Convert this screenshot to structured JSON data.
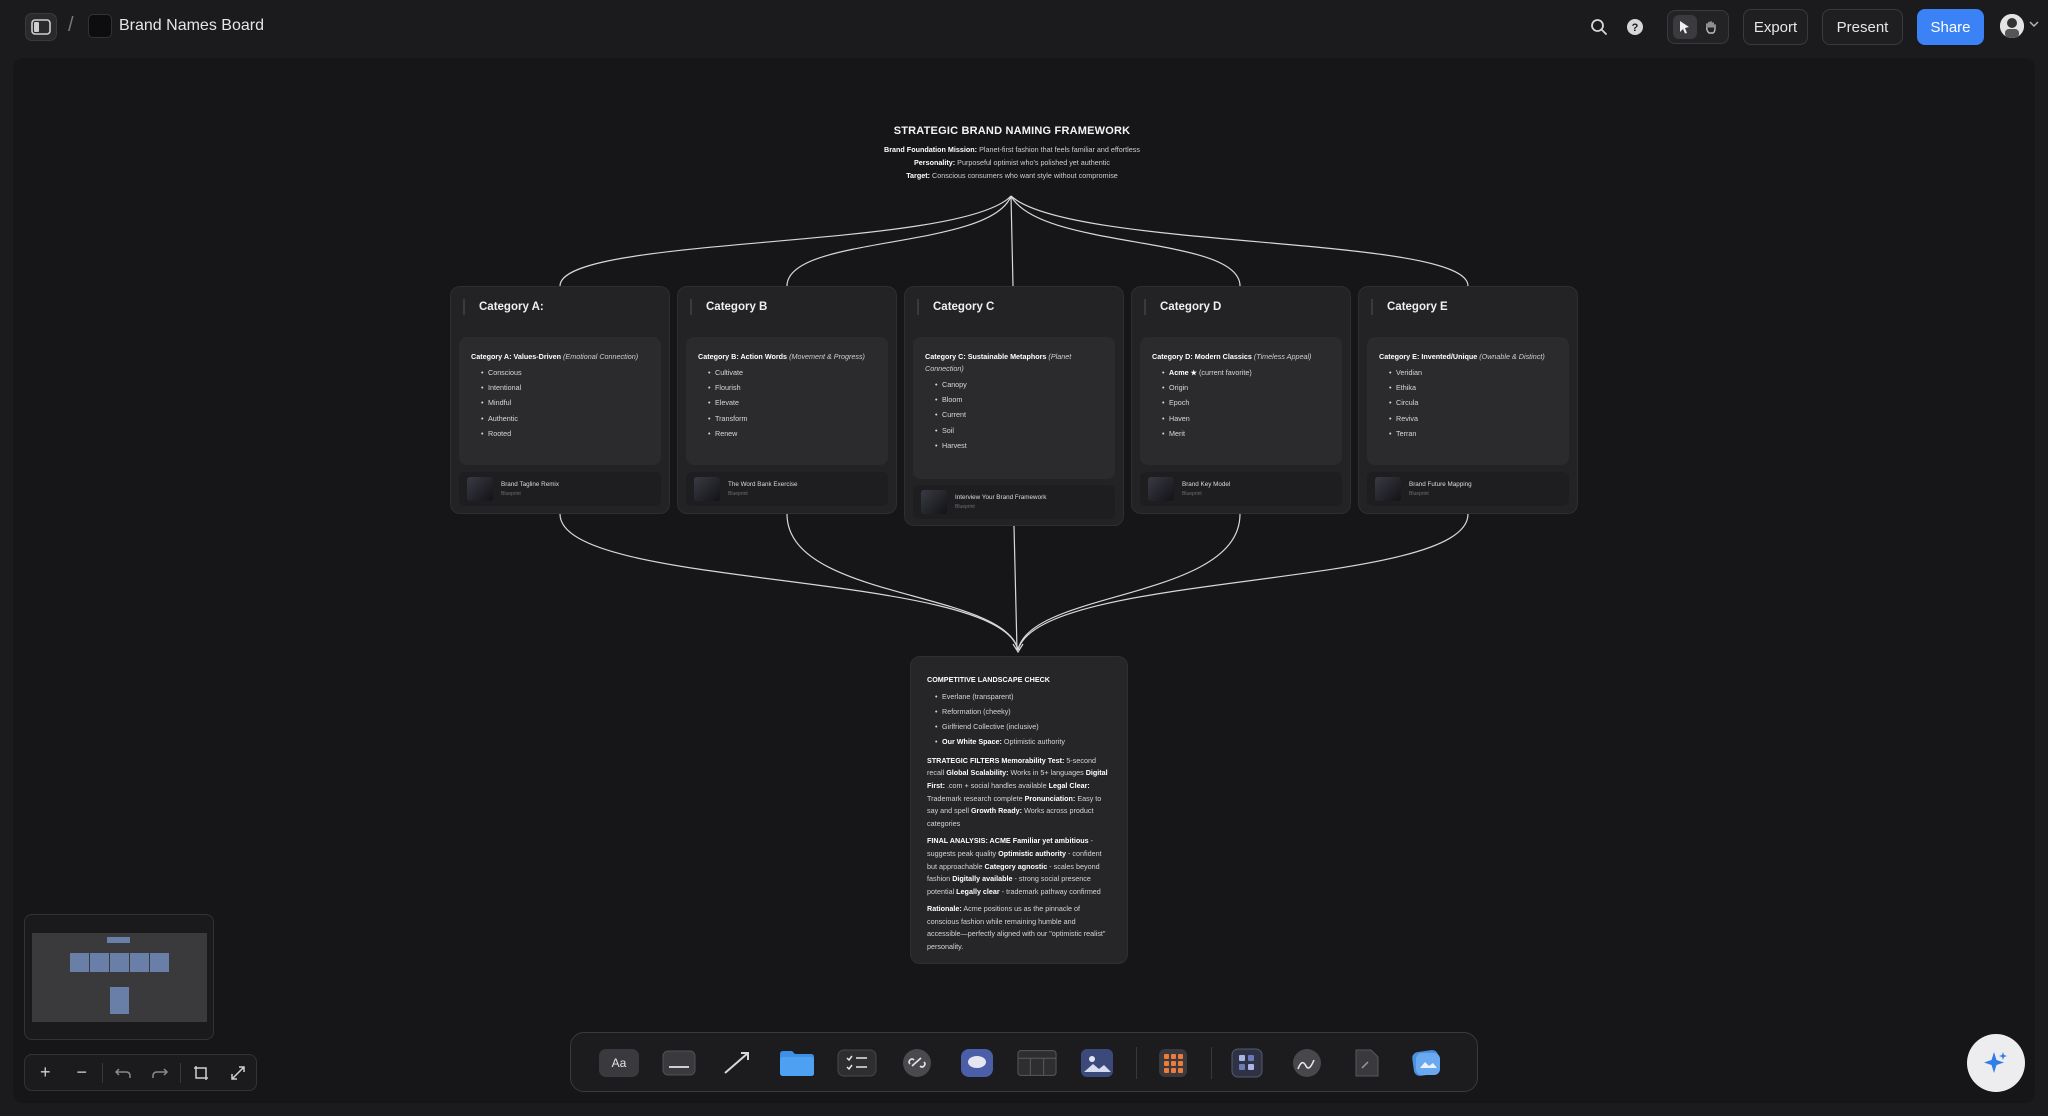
{
  "topbar": {
    "board_title": "Brand Names Board",
    "export_label": "Export",
    "present_label": "Present",
    "share_label": "Share"
  },
  "colors": {
    "accent": "#3b82f6",
    "canvas": "#161618",
    "card": "#232326"
  },
  "framework": {
    "title": "STRATEGIC BRAND NAMING FRAMEWORK",
    "foundation_label": "Brand Foundation Mission:",
    "mission_text": "Planet-first fashion that feels familiar and effortless",
    "personality_label": "Personality:",
    "personality_text": "Purposeful optimist who's polished yet authentic",
    "target_label": "Target:",
    "target_text": "Conscious consumers who want style without compromise"
  },
  "categories": [
    {
      "header": "Category A:",
      "title": "Category A: Values-Driven",
      "subtitle": "(Emotional Connection)",
      "items": [
        "Conscious",
        "Intentional",
        "Mindful",
        "Authentic",
        "Rooted"
      ],
      "doc_title": "Brand Tagline Remix",
      "doc_sub": "Blueprint"
    },
    {
      "header": "Category B",
      "title": "Category B: Action Words",
      "subtitle": "(Movement & Progress)",
      "items": [
        "Cultivate",
        "Flourish",
        "Elevate",
        "Transform",
        "Renew"
      ],
      "doc_title": "The Word Bank Exercise",
      "doc_sub": "Blueprint"
    },
    {
      "header": "Category C",
      "title": "Category C: Sustainable Metaphors",
      "subtitle": "(Planet Connection)",
      "items": [
        "Canopy",
        "Bloom",
        "Current",
        "Soil",
        "Harvest"
      ],
      "doc_title": "Interview Your Brand Framework",
      "doc_sub": "Blueprint"
    },
    {
      "header": "Category D",
      "title": "Category D: Modern Classics",
      "subtitle": "(Timeless Appeal)",
      "first_bold": "Acme ★",
      "first_rest": " (current favorite)",
      "items": [
        "Origin",
        "Epoch",
        "Haven",
        "Merit"
      ],
      "doc_title": "Brand Key Model",
      "doc_sub": "Blueprint"
    },
    {
      "header": "Category E",
      "title": "Category E: Invented/Unique",
      "subtitle": "(Ownable & Distinct)",
      "items": [
        "Veridian",
        "Ethika",
        "Circula",
        "Reviva",
        "Terran"
      ],
      "doc_title": "Brand Future Mapping",
      "doc_sub": "Blueprint"
    }
  ],
  "competitive": {
    "title": "COMPETITIVE LANDSCAPE CHECK",
    "items": [
      "Everlane (transparent)",
      "Reformation (cheeky)",
      "Girlfriend Collective (inclusive)"
    ],
    "white_space_label": "Our White Space:",
    "white_space_text": " Optimistic authority",
    "filters_label": "STRATEGIC FILTERS Memorability Test:",
    "filters_1": " 5-second recall ",
    "global_label": "Global Scalability:",
    "global_text": " Works in 5+ languages ",
    "digital_label": "Digital First:",
    "digital_text": " .com + social handles available ",
    "legal_label": "Legal Clear:",
    "legal_text": " Trademark research complete ",
    "pron_label": "Pronunciation:",
    "pron_text": " Easy to say and spell ",
    "growth_label": "Growth Ready:",
    "growth_text": " Works across product categories",
    "final_label": "FINAL ANALYSIS: ACME Familiar yet ambitious",
    "final_1": " - suggests peak quality ",
    "opt_label": "Optimistic authority",
    "opt_text": " - confident but approachable ",
    "agn_label": "Category agnostic",
    "agn_text": " - scales beyond fashion ",
    "dig_label": "Digitally available",
    "dig_text": " - strong social presence potential ",
    "leg_label": "Legally clear",
    "leg_text": " - trademark pathway confirmed",
    "rationale_label": "Rationale:",
    "rationale_text": " Acme positions us as the pinnacle of conscious fashion while remaining humble and accessible—perfectly aligned with our \"optimistic realist\" personality."
  },
  "toolbar": {
    "text_tool_label": "Aa",
    "icons": [
      "text-icon",
      "shape-icon",
      "arrow-icon",
      "folder-icon",
      "checklist-icon",
      "link-icon",
      "comment-icon",
      "table-icon",
      "image-icon",
      "apps-icon",
      "component-icon",
      "draw-icon",
      "file-icon",
      "ai-image-icon"
    ]
  },
  "zoom": {
    "plus": "+",
    "minus": "−"
  }
}
